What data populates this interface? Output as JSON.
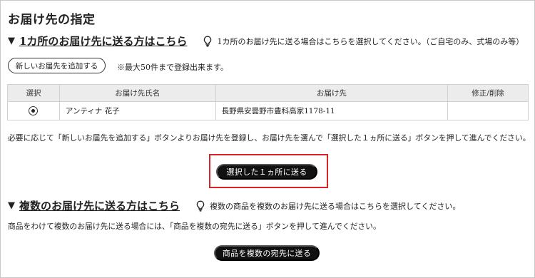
{
  "page": {
    "title": "お届け先の指定"
  },
  "single": {
    "triangle": "▼",
    "link_label": "1カ所のお届け先に送る方はこちら",
    "hint": "1カ所のお届け先に送る場合はこちらを選択してください。（ご自宅のみ、式場のみ等）",
    "add_button": "新しいお届先を追加する",
    "note": "※最大50件まで登録出来ます。",
    "columns": [
      "選択",
      "お届け先氏名",
      "お届け先",
      "修正/削除"
    ],
    "rows": [
      {
        "selected": true,
        "name": "アンティナ 花子",
        "address": "長野県安曇野市豊科高家1178-11",
        "actions": ""
      }
    ],
    "instruction": "必要に応じて「新しいお届先を追加する」ボタンよりお届け先を登録し、お届け先を選んで「選択した１ヵ所に送る」ボタンを押して進んでください。",
    "submit_button": "選択した１ヵ所に送る"
  },
  "multiple": {
    "triangle": "▼",
    "link_label": "複数のお届け先に送る方はこちら",
    "hint": "複数の商品を複数のお届け先に送る場合はこちらを選択してください。",
    "instruction": "商品をわけて複数のお届け先に送る場合には、「商品を複数の宛先に送る」ボタンを押して進んでください。",
    "submit_button": "商品を複数の宛先に送る"
  },
  "colors": {
    "highlight": "#d9232a",
    "button_bg": "#111111",
    "table_header_bg": "#ececec"
  },
  "icons": {
    "hint_icon": "lightbulb-pin-icon"
  }
}
